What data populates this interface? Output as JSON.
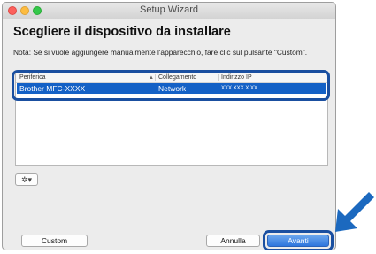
{
  "window": {
    "title": "Setup Wizard"
  },
  "heading": "Scegliere il dispositivo da installare",
  "note": "Nota: Se si vuole aggiungere manualmente l'apparecchio, fare clic sul pulsante \"Custom\".",
  "table": {
    "columns": [
      "Periferica",
      "Collegamento",
      "Indirizzo IP"
    ],
    "rows": [
      {
        "device": "Brother MFC-XXXX",
        "connection": "Network",
        "ip": "XXX.XXX.X.XX",
        "selected": true
      }
    ]
  },
  "gear_button": {
    "icon": "gear-icon",
    "glyph": "✲▾"
  },
  "buttons": {
    "custom": "Custom",
    "cancel": "Annulla",
    "next": "Avanti"
  },
  "colors": {
    "selection": "#1461c6",
    "callout": "#1a4fa0",
    "arrow": "#1c69bf"
  }
}
